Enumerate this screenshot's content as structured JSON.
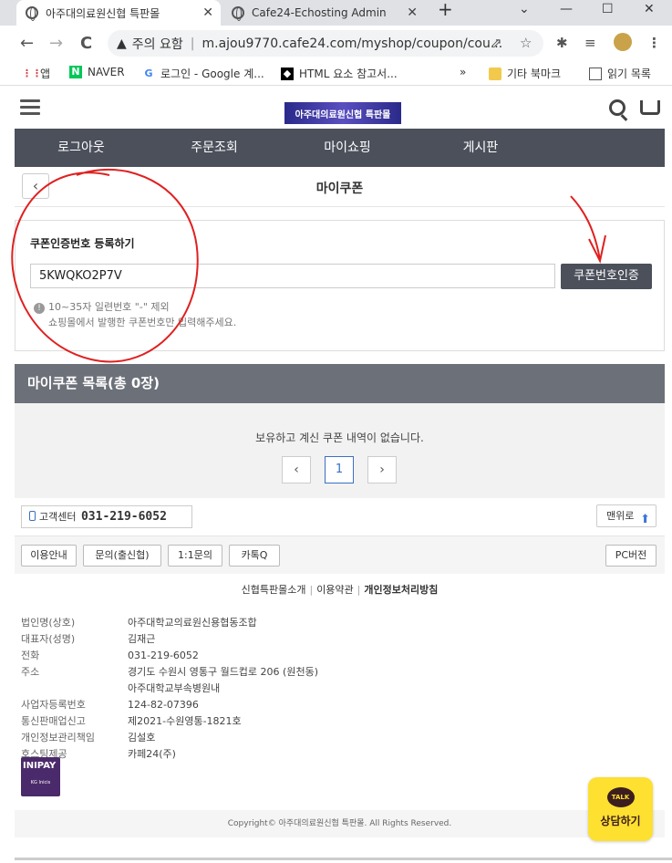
{
  "browser": {
    "tabs": [
      {
        "title": "아주대의료원신협 특판몰",
        "close": "✕"
      },
      {
        "title": "Cafe24-Echosting Admin",
        "close": "✕"
      }
    ],
    "new_tab": "+",
    "win_controls": {
      "chevron": "⌄",
      "minimize": "—",
      "maximize": "☐",
      "close": "✕"
    },
    "nav": {
      "back": "←",
      "forward": "→",
      "reload": "C"
    },
    "address": {
      "warning": "주의 요함",
      "warn_icon": "▲",
      "url": "m.ajou9770.cafe24.com/myshop/coupon/cou..."
    },
    "toolbar_icons": {
      "share": "⇗",
      "star": "☆",
      "ext": "✱",
      "media": "≡",
      "menu": "⋮"
    },
    "bookmarks": [
      {
        "label": "앱",
        "icon": "⋮⋮"
      },
      {
        "label": "NAVER",
        "icon": "N"
      },
      {
        "label": "로그인 - Google 계...",
        "icon": "G"
      },
      {
        "label": "HTML 요소 참고서...",
        "icon": "◆"
      }
    ],
    "bookmarks_more": "»",
    "bookmark_folder": "기타 북마크",
    "reading_list": "읽기 목록"
  },
  "site": {
    "logo": "아주대의료원신협 특판몰",
    "gnb": [
      "로그아웃",
      "주문조회",
      "마이쇼핑",
      "게시판"
    ],
    "back_label": "‹",
    "page_title": "마이쿠폰",
    "coupon_register": {
      "title": "쿠폰인증번호 등록하기",
      "input_value": "5KWQKO2P7V",
      "button": "쿠폰번호인증",
      "info_icon": "!",
      "info_line1": "10~35자 일련번호 \"-\" 제외",
      "info_line2": "쇼핑몰에서 발행한 쿠폰번호만 입력해주세요."
    },
    "coupon_list": {
      "title": "마이쿠폰 목록(총 0장)",
      "empty_message": "보유하고 계신 쿠폰 내역이 없습니다.",
      "pager": {
        "prev": "‹",
        "page": "1",
        "next": "›"
      }
    },
    "footer": {
      "cs_label": "고객센터",
      "cs_phone": "031-219-6052",
      "to_top": "맨위로",
      "to_top_icon": "⬆",
      "buttons": [
        "이용안내",
        "문의(출신협)",
        "1:1문의",
        "카톡Q"
      ],
      "pc_version": "PC버전",
      "links": [
        "신협특판몰소개",
        "이용약관",
        "개인정보처리방침"
      ],
      "biz_info": [
        {
          "k": "법인명(상호)",
          "v": "아주대학교의료원신용협동조합"
        },
        {
          "k": "대표자(성명)",
          "v": "김재근"
        },
        {
          "k": "전화",
          "v": "031-219-6052"
        },
        {
          "k": "주소",
          "v": "경기도 수원시 영통구 월드컵로 206 (원천동)"
        },
        {
          "k": "",
          "v": "아주대학교부속병원내"
        },
        {
          "k": "사업자등록번호",
          "v": "124-82-07396"
        },
        {
          "k": "통신판매업신고",
          "v": "제2021-수원영통-1821호"
        },
        {
          "k": "개인정보관리책임",
          "v": "김설호"
        },
        {
          "k": "호스팅제공",
          "v": "카페24(주)"
        }
      ],
      "inipay": "INIPAY",
      "inipay_sub": "KG Inicis",
      "copyright": "Copyright© 아주대의료원신협 특판몰. All Rights Reserved."
    },
    "talk": {
      "bubble": "TALK",
      "label": "상담하기"
    }
  },
  "colors": {
    "gnb": "#4b505b",
    "list_head": "#6c7079",
    "annotation": "#e02020",
    "talk": "#fde030"
  }
}
